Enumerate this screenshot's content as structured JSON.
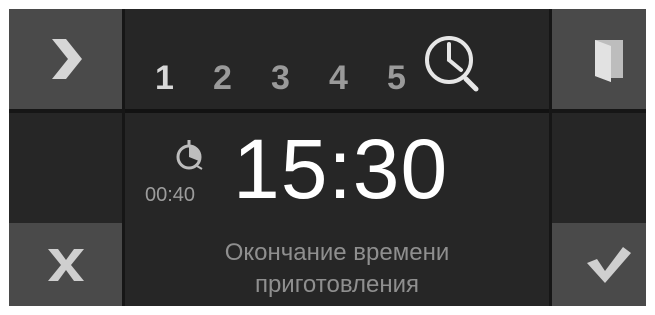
{
  "levels": [
    "1",
    "2",
    "3",
    "4",
    "5"
  ],
  "duration": "00:40",
  "end_time": "15:30",
  "caption": {
    "line1": "Окончание времени",
    "line2": "приготовления"
  },
  "icons": {
    "next": "chevron-right-icon",
    "door": "door-icon",
    "cancel": "close-icon",
    "confirm": "checkmark-icon",
    "clock": "clock-search-icon",
    "timer": "timer-icon"
  },
  "colors": {
    "button_bg": "#4a4a4a",
    "panel_bg": "#262626",
    "text_primary": "#ffffff",
    "text_dim": "#9a9a9a"
  }
}
